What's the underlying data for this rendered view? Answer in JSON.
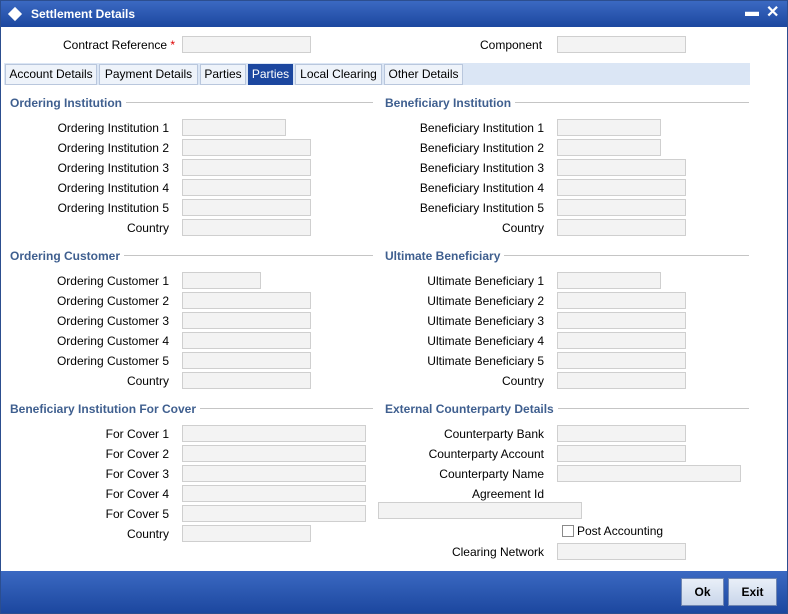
{
  "window": {
    "title": "Settlement Details",
    "minimize_icon": "minimize-icon",
    "close_icon": "close-icon"
  },
  "header": {
    "contract_reference_label": "Contract Reference",
    "required_mark": "*",
    "component_label": "Component"
  },
  "tabs": [
    "Account Details",
    "Payment Details",
    "Parties",
    "Parties",
    "Local Clearing",
    "Other Details"
  ],
  "active_tab": "Parties",
  "ordering_institution": {
    "title": "Ordering Institution",
    "labels": [
      "Ordering Institution 1",
      "Ordering Institution 2",
      "Ordering Institution 3",
      "Ordering Institution 4",
      "Ordering Institution 5",
      "Country"
    ]
  },
  "beneficiary_institution": {
    "title": "Beneficiary Institution",
    "labels": [
      "Beneficiary Institution 1",
      "Beneficiary Institution 2",
      "Beneficiary Institution 3",
      "Beneficiary Institution 4",
      "Beneficiary Institution 5",
      "Country"
    ]
  },
  "ordering_customer": {
    "title": "Ordering Customer",
    "labels": [
      "Ordering Customer 1",
      "Ordering Customer 2",
      "Ordering Customer 3",
      "Ordering Customer 4",
      "Ordering Customer 5",
      "Country"
    ]
  },
  "ultimate_beneficiary": {
    "title": "Ultimate Beneficiary",
    "labels": [
      "Ultimate Beneficiary 1",
      "Ultimate Beneficiary 2",
      "Ultimate Beneficiary 3",
      "Ultimate Beneficiary 4",
      "Ultimate Beneficiary 5",
      "Country"
    ]
  },
  "cover": {
    "title": "Beneficiary Institution For Cover",
    "labels": [
      "For Cover 1",
      "For Cover 2",
      "For Cover 3",
      "For Cover 4",
      "For Cover 5",
      "Country"
    ]
  },
  "external": {
    "title": "External Counterparty Details",
    "counterparty_bank": "Counterparty Bank",
    "counterparty_account": "Counterparty Account",
    "counterparty_name": "Counterparty Name",
    "agreement_id": "Agreement Id",
    "post_accounting": "Post Accounting",
    "clearing_network": "Clearing Network"
  },
  "footer": {
    "ok": "Ok",
    "exit": "Exit"
  },
  "colors": {
    "titlebar": "#1c479f",
    "section_title": "#3f5f8f",
    "active_tab": "#1c479f",
    "required": "#dd0000"
  }
}
